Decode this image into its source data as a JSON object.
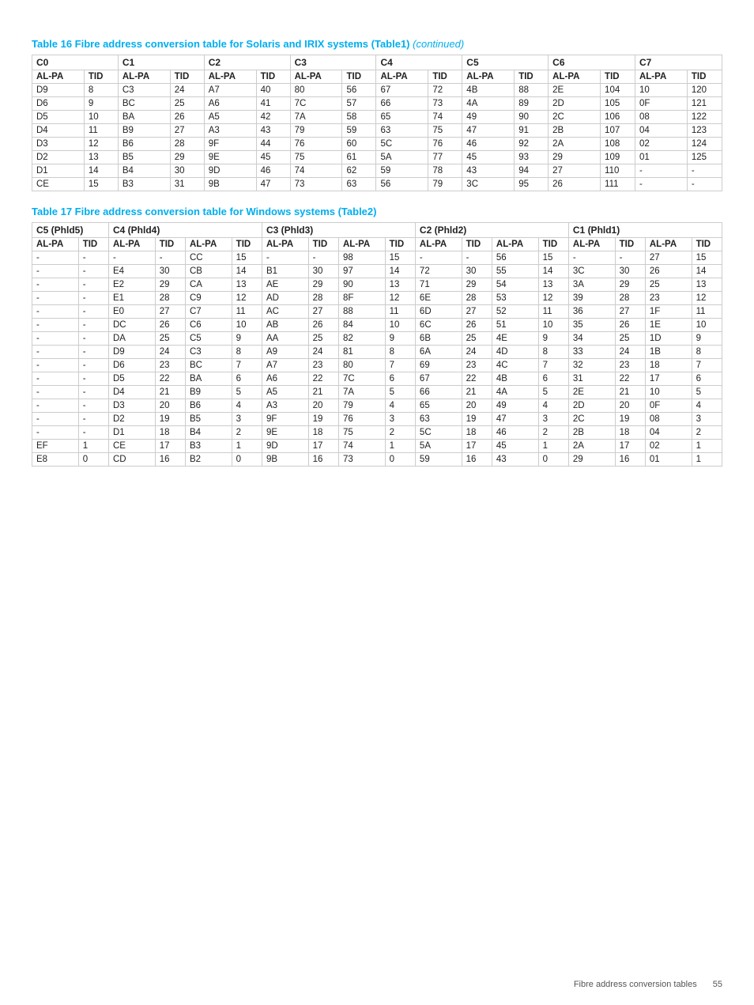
{
  "table16": {
    "title": "Table 16 Fibre address conversion table for Solaris and IRIX systems (Table1)",
    "continued": "(continued)",
    "columns": [
      "C0",
      "C1",
      "C2",
      "C3",
      "C4",
      "C5",
      "C6",
      "C7"
    ],
    "subheaders": [
      "AL-PA",
      "TID",
      "AL-PA",
      "TID",
      "AL-PA",
      "TID",
      "AL-PA",
      "TID",
      "AL-PA",
      "TID",
      "AL-PA",
      "TID",
      "AL-PA",
      "TID",
      "AL-PA",
      "TID"
    ],
    "rows": [
      [
        "D9",
        "8",
        "C3",
        "24",
        "A7",
        "40",
        "80",
        "56",
        "67",
        "72",
        "4B",
        "88",
        "2E",
        "104",
        "10",
        "120"
      ],
      [
        "D6",
        "9",
        "BC",
        "25",
        "A6",
        "41",
        "7C",
        "57",
        "66",
        "73",
        "4A",
        "89",
        "2D",
        "105",
        "0F",
        "121"
      ],
      [
        "D5",
        "10",
        "BA",
        "26",
        "A5",
        "42",
        "7A",
        "58",
        "65",
        "74",
        "49",
        "90",
        "2C",
        "106",
        "08",
        "122"
      ],
      [
        "D4",
        "11",
        "B9",
        "27",
        "A3",
        "43",
        "79",
        "59",
        "63",
        "75",
        "47",
        "91",
        "2B",
        "107",
        "04",
        "123"
      ],
      [
        "D3",
        "12",
        "B6",
        "28",
        "9F",
        "44",
        "76",
        "60",
        "5C",
        "76",
        "46",
        "92",
        "2A",
        "108",
        "02",
        "124"
      ],
      [
        "D2",
        "13",
        "B5",
        "29",
        "9E",
        "45",
        "75",
        "61",
        "5A",
        "77",
        "45",
        "93",
        "29",
        "109",
        "01",
        "125"
      ],
      [
        "D1",
        "14",
        "B4",
        "30",
        "9D",
        "46",
        "74",
        "62",
        "59",
        "78",
        "43",
        "94",
        "27",
        "110",
        "-",
        "-"
      ],
      [
        "CE",
        "15",
        "B3",
        "31",
        "9B",
        "47",
        "73",
        "63",
        "56",
        "79",
        "3C",
        "95",
        "26",
        "111",
        "-",
        "-"
      ]
    ]
  },
  "table17": {
    "title": "Table 17 Fibre address conversion table for Windows systems (Table2)",
    "columns": [
      "C5 (Phld5)",
      "C4 (Phld4)",
      "C3 (Phld3)",
      "C2 (Phld2)",
      "C1 (Phld1)"
    ],
    "subheaders": [
      "AL-PA",
      "TID",
      "AL-PA",
      "TID",
      "AL-PA",
      "TID",
      "AL-PA",
      "TID",
      "AL-PA",
      "TID",
      "AL-PA",
      "TID",
      "AL-PA",
      "TID",
      "AL-PA",
      "TID",
      "AL-PA",
      "TID"
    ],
    "rows": [
      [
        "-",
        "-",
        "-",
        "-",
        "CC",
        "15",
        "-",
        "-",
        "98",
        "15",
        "-",
        "-",
        "56",
        "15",
        "-",
        "-",
        "27",
        "15"
      ],
      [
        "-",
        "-",
        "E4",
        "30",
        "CB",
        "14",
        "B1",
        "30",
        "97",
        "14",
        "72",
        "30",
        "55",
        "14",
        "3C",
        "30",
        "26",
        "14"
      ],
      [
        "-",
        "-",
        "E2",
        "29",
        "CA",
        "13",
        "AE",
        "29",
        "90",
        "13",
        "71",
        "29",
        "54",
        "13",
        "3A",
        "29",
        "25",
        "13"
      ],
      [
        "-",
        "-",
        "E1",
        "28",
        "C9",
        "12",
        "AD",
        "28",
        "8F",
        "12",
        "6E",
        "28",
        "53",
        "12",
        "39",
        "28",
        "23",
        "12"
      ],
      [
        "-",
        "-",
        "E0",
        "27",
        "C7",
        "11",
        "AC",
        "27",
        "88",
        "11",
        "6D",
        "27",
        "52",
        "11",
        "36",
        "27",
        "1F",
        "11"
      ],
      [
        "-",
        "-",
        "DC",
        "26",
        "C6",
        "10",
        "AB",
        "26",
        "84",
        "10",
        "6C",
        "26",
        "51",
        "10",
        "35",
        "26",
        "1E",
        "10"
      ],
      [
        "-",
        "-",
        "DA",
        "25",
        "C5",
        "9",
        "AA",
        "25",
        "82",
        "9",
        "6B",
        "25",
        "4E",
        "9",
        "34",
        "25",
        "1D",
        "9"
      ],
      [
        "-",
        "-",
        "D9",
        "24",
        "C3",
        "8",
        "A9",
        "24",
        "81",
        "8",
        "6A",
        "24",
        "4D",
        "8",
        "33",
        "24",
        "1B",
        "8"
      ],
      [
        "-",
        "-",
        "D6",
        "23",
        "BC",
        "7",
        "A7",
        "23",
        "80",
        "7",
        "69",
        "23",
        "4C",
        "7",
        "32",
        "23",
        "18",
        "7"
      ],
      [
        "-",
        "-",
        "D5",
        "22",
        "BA",
        "6",
        "A6",
        "22",
        "7C",
        "6",
        "67",
        "22",
        "4B",
        "6",
        "31",
        "22",
        "17",
        "6"
      ],
      [
        "-",
        "-",
        "D4",
        "21",
        "B9",
        "5",
        "A5",
        "21",
        "7A",
        "5",
        "66",
        "21",
        "4A",
        "5",
        "2E",
        "21",
        "10",
        "5"
      ],
      [
        "-",
        "-",
        "D3",
        "20",
        "B6",
        "4",
        "A3",
        "20",
        "79",
        "4",
        "65",
        "20",
        "49",
        "4",
        "2D",
        "20",
        "0F",
        "4"
      ],
      [
        "-",
        "-",
        "D2",
        "19",
        "B5",
        "3",
        "9F",
        "19",
        "76",
        "3",
        "63",
        "19",
        "47",
        "3",
        "2C",
        "19",
        "08",
        "3"
      ],
      [
        "-",
        "-",
        "D1",
        "18",
        "B4",
        "2",
        "9E",
        "18",
        "75",
        "2",
        "5C",
        "18",
        "46",
        "2",
        "2B",
        "18",
        "04",
        "2"
      ],
      [
        "EF",
        "1",
        "CE",
        "17",
        "B3",
        "1",
        "9D",
        "17",
        "74",
        "1",
        "5A",
        "17",
        "45",
        "1",
        "2A",
        "17",
        "02",
        "1"
      ],
      [
        "E8",
        "0",
        "CD",
        "16",
        "B2",
        "0",
        "9B",
        "16",
        "73",
        "0",
        "59",
        "16",
        "43",
        "0",
        "29",
        "16",
        "01",
        "1"
      ]
    ]
  },
  "footer": {
    "text": "Fibre address conversion tables",
    "page": "55"
  }
}
